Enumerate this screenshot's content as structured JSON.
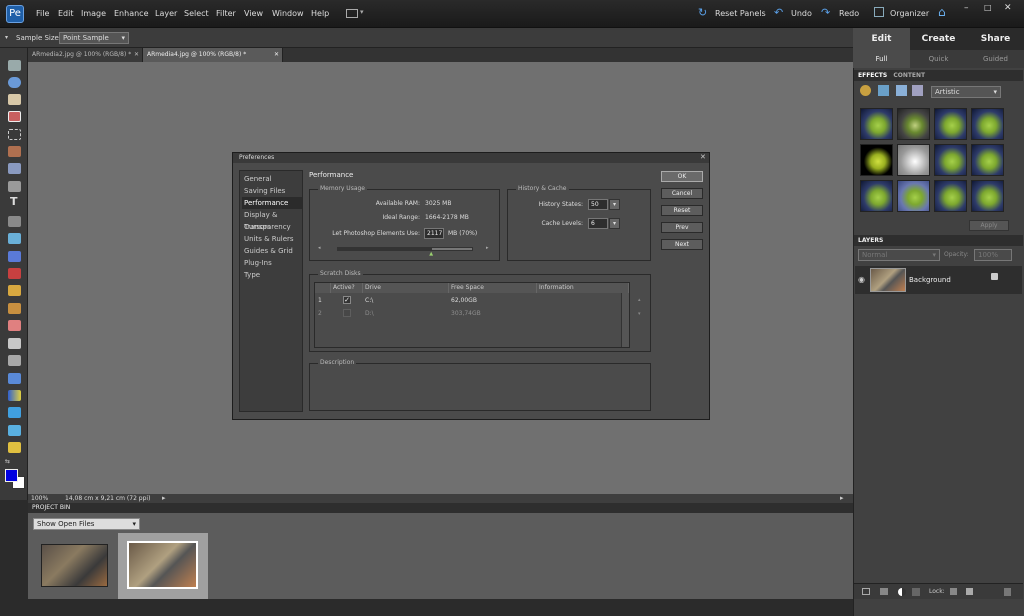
{
  "menubar": {
    "logo_glyph": "Pe",
    "items": [
      "File",
      "Edit",
      "Image",
      "Enhance",
      "Layer",
      "Select",
      "Filter",
      "View",
      "Window",
      "Help"
    ],
    "reset_panels": "Reset Panels",
    "undo": "Undo",
    "redo": "Redo",
    "organizer": "Organizer"
  },
  "options": {
    "sample_label": "Sample Size:",
    "sample_value": "Point Sample"
  },
  "doc_tabs": [
    "ARmedia2.jpg @ 100% (RGB/8) *",
    "ARmedia4.jpg @ 100% (RGB/8) *"
  ],
  "status": {
    "zoom": "100%",
    "size": "14,08 cm x 9,21 cm (72 ppi)"
  },
  "project_bin": {
    "title": "PROJECT BIN",
    "dropdown": "Show Open Files"
  },
  "mode_tabs": [
    "Edit",
    "Create",
    "Share"
  ],
  "edit_subtabs": [
    "Full",
    "Quick",
    "Guided"
  ],
  "effects": {
    "tabs": [
      "EFFECTS",
      "CONTENT"
    ],
    "category": "Artistic",
    "apply": "Apply"
  },
  "layers": {
    "title": "LAYERS",
    "mode": "Normal",
    "opacity_label": "Opacity:",
    "opacity_value": "100%",
    "layer_name": "Background",
    "lock_label": "Lock:"
  },
  "dialog": {
    "title": "Preferences",
    "nav": [
      "General",
      "Saving Files",
      "Performance",
      "Display & Cursors",
      "Transparency",
      "Units & Rulers",
      "Guides & Grid",
      "Plug-Ins",
      "Type"
    ],
    "selected": "Performance",
    "section_title": "Performance",
    "memory": {
      "title": "Memory Usage",
      "available_label": "Available RAM:",
      "available_value": "3025 MB",
      "ideal_label": "Ideal Range:",
      "ideal_value": "1664-2178 MB",
      "let_label": "Let Photoshop Elements Use:",
      "let_value": "2117",
      "let_suffix": "MB (70%)",
      "slider_fraction": 0.7
    },
    "history": {
      "title": "History & Cache",
      "states_label": "History States:",
      "states_value": "50",
      "cache_label": "Cache Levels:",
      "cache_value": "6"
    },
    "buttons": [
      "OK",
      "Cancel",
      "Reset",
      "Prev",
      "Next"
    ],
    "scratch": {
      "title": "Scratch Disks",
      "headers": [
        "",
        "Active?",
        "Drive",
        "Free Space",
        "Information"
      ],
      "rows": [
        {
          "num": "1",
          "active": true,
          "drive": "C:\\",
          "free": "62,00GB",
          "info": ""
        },
        {
          "num": "2",
          "active": false,
          "drive": "D:\\",
          "free": "303,74GB",
          "info": ""
        }
      ]
    },
    "description": {
      "title": "Description"
    }
  },
  "colors": {
    "accent": "#1f5fa8",
    "canvas": "#707070"
  }
}
